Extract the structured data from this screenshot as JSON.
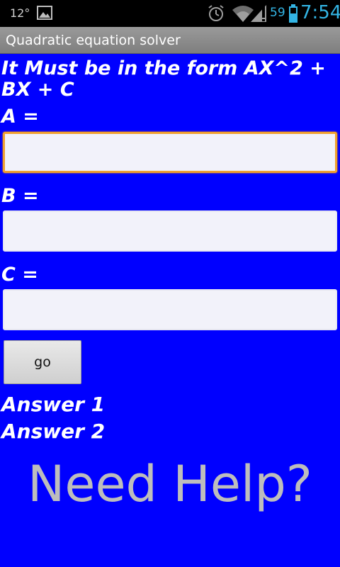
{
  "status_bar": {
    "temperature": "12°",
    "battery_percent": "59",
    "time": "7:54",
    "icons": [
      "photo-icon",
      "alarm-icon",
      "wifi-icon",
      "signal-icon",
      "battery-icon"
    ],
    "accent_color": "#33b5e5"
  },
  "app": {
    "title": "Quadratic equation solver"
  },
  "form": {
    "instruction": "It Must be in the form AX^2 + BX + C",
    "fields": [
      {
        "label": "A =",
        "value": "",
        "focused": true
      },
      {
        "label": "B =",
        "value": ""
      },
      {
        "label": "C =",
        "value": ""
      }
    ],
    "go_label": "go"
  },
  "answers": {
    "answer1": "Answer 1",
    "answer2": "Answer 2"
  },
  "help": {
    "label": "Need Help?"
  },
  "colors": {
    "background": "#0000ff",
    "text": "#ffffff",
    "help_text": "#bdbdbd",
    "focus_border": "#f0a030"
  }
}
